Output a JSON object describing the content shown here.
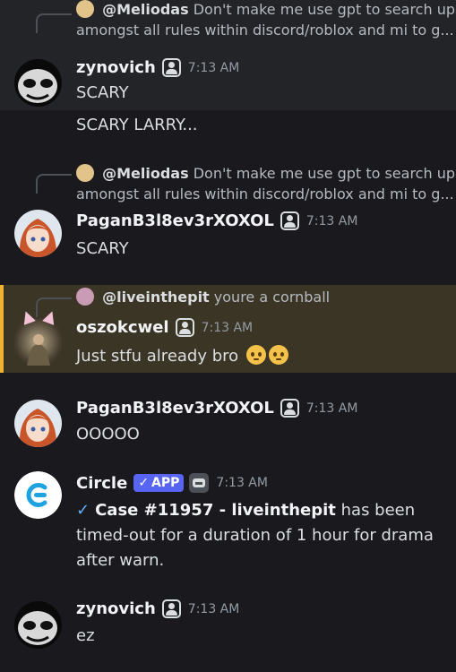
{
  "messages": [
    {
      "reply": {
        "author": "@Meliodas",
        "text": "Don't make me use gpt to search up",
        "text2": "amongst all rules within discord/roblox and mi to g..."
      },
      "author": "zynovich",
      "time": "7:13 AM",
      "lines": [
        "SCARY",
        "SCARY LARRY..."
      ]
    },
    {
      "reply": {
        "author": "@Meliodas",
        "text": "Don't make me use gpt to search up",
        "text2": "amongst all rules within discord/roblox and mi to g..."
      },
      "author": "PaganB3l8ev3rXOXOL",
      "time": "7:13 AM",
      "lines": [
        "SCARY"
      ]
    },
    {
      "reply": {
        "author": "@liveinthepit",
        "text": "youre a cornball"
      },
      "author": "oszokcwel",
      "time": "7:13 AM",
      "lines": [
        "Just stfu already bro"
      ]
    },
    {
      "author": "PaganB3l8ev3rXOXOL",
      "time": "7:13 AM",
      "lines": [
        "OOOOO"
      ]
    },
    {
      "author": "Circle",
      "app_tag": "APP",
      "time": "7:13 AM",
      "case": "Case #11957 - liveinthepit",
      "text": "has been timed-out for a duration of 1 hour for drama after warn."
    },
    {
      "author": "zynovich",
      "time": "7:13 AM",
      "lines": [
        "ez"
      ]
    }
  ],
  "colors": {
    "background": "#1a1a1e",
    "mention_highlight": "#3b3526",
    "mention_bar": "#f0b232",
    "app_tag": "#5865f2",
    "circle_brand": "#1fa3e0"
  },
  "icons": [
    "user-badge-icon",
    "checkmark-icon",
    "robot-icon",
    "pleading-face-emoji"
  ]
}
